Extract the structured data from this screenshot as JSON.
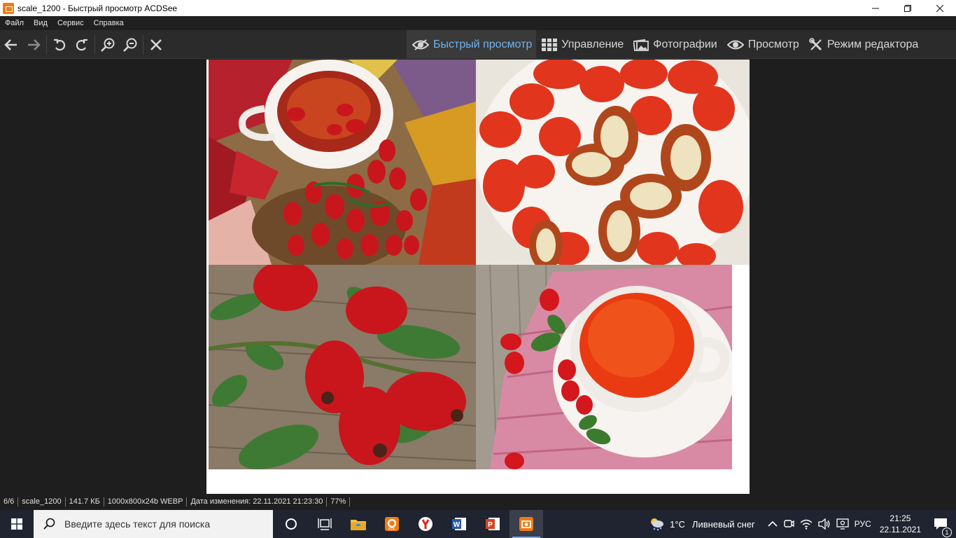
{
  "window": {
    "title": "scale_1200 - Быстрый просмотр ACDSee",
    "controls": [
      "minimize-icon",
      "maximize-icon",
      "close-icon"
    ]
  },
  "menu": [
    "Файл",
    "Вид",
    "Сервис",
    "Справка"
  ],
  "toolbar": {
    "icons": [
      "back-arrow-icon",
      "forward-arrow-icon",
      "rotate-left-icon",
      "rotate-right-icon",
      "zoom-in-icon",
      "zoom-out-icon",
      "close-icon"
    ]
  },
  "mode_tabs": [
    {
      "label": "Быстрый просмотр",
      "icon": "eye-icon",
      "active": true
    },
    {
      "label": "Управление",
      "icon": "grid-icon",
      "active": false
    },
    {
      "label": "Фотографии",
      "icon": "photos-icon",
      "active": false
    },
    {
      "label": "Просмотр",
      "icon": "eye-icon",
      "active": false
    },
    {
      "label": "Режим редактора",
      "icon": "tools-icon",
      "active": false
    }
  ],
  "image": {
    "panels": [
      "rosehip-tea-with-autumn-leaves",
      "rosehips-halved-in-bowl",
      "rosehips-on-branch-wood",
      "rosehip-tea-cup-on-pink-cloth"
    ]
  },
  "status": {
    "position": "6/6",
    "filename": "scale_1200",
    "size": "141.7 КБ",
    "format": "1000x800x24b WEBP",
    "modified": "Дата изменения: 22.11.2021 21:23:30",
    "zoom": "77%"
  },
  "taskbar": {
    "search_placeholder": "Введите здесь текст для поиска",
    "apps": [
      "cortana-icon",
      "task-view-icon",
      "file-explorer-icon",
      "pdf-app-icon",
      "yandex-browser-icon",
      "word-icon",
      "powerpoint-icon",
      "acdsee-icon"
    ],
    "weather_temp": "1°C",
    "weather_text": "Ливневый снег",
    "language": "РУС",
    "time": "21:25",
    "date": "22.11.2021",
    "notification_count": "1"
  },
  "colors": {
    "accent": "#6fb4f0",
    "app_orange": "#f07a12",
    "toolbar_bg": "#2b2b2b",
    "viewer_bg": "#1e1e1e"
  }
}
